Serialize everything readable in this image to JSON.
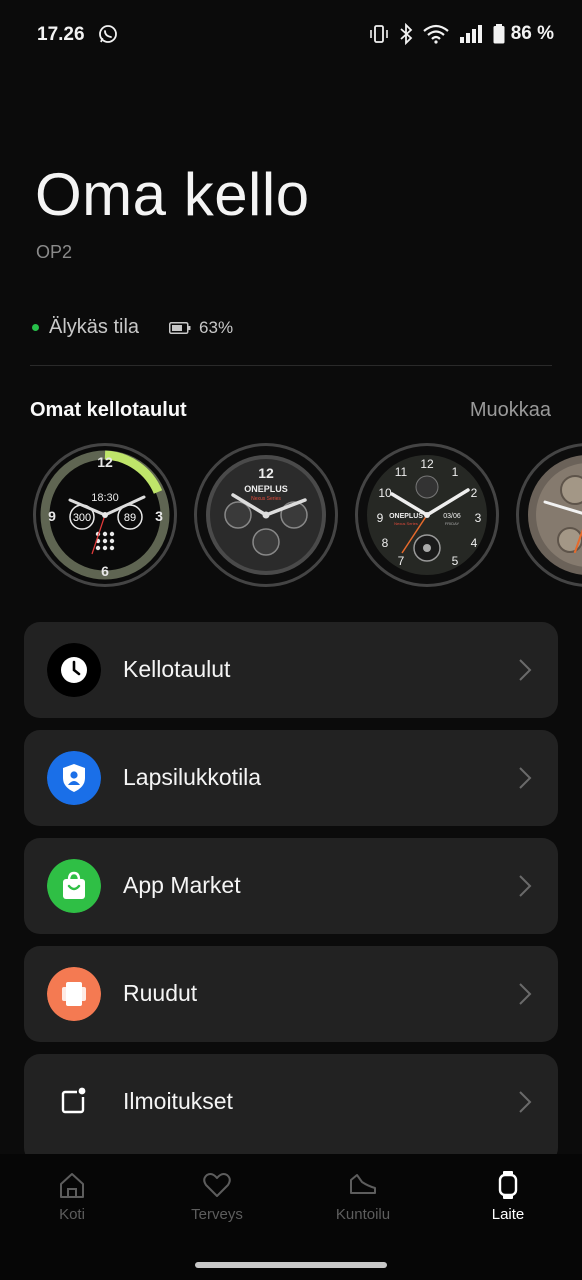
{
  "status_bar": {
    "time": "17.26",
    "battery": "86 %"
  },
  "header": {
    "title": "Oma kello",
    "device": "OP2"
  },
  "device_status": {
    "mode": "Älykäs tila",
    "battery": "63%"
  },
  "watch_faces": {
    "heading": "Omat kellotaulut",
    "edit_label": "Muokkaa",
    "faces": [
      {
        "time": "18:30",
        "left_value": "300",
        "right_value": "89",
        "top_number": "12",
        "left_number": "9",
        "right_number": "3",
        "bottom_number": "6"
      },
      {
        "brand": "ONEPLUS",
        "sub": "Nexus Series",
        "top_number": "12"
      },
      {
        "brand": "ONEPLUS",
        "sub": "Nexus Series",
        "date": "03/06",
        "day": "FRIDAY"
      },
      {
        "name": "chronograph"
      }
    ]
  },
  "menu": [
    {
      "label": "Kellotaulut",
      "icon": "clock-icon",
      "color": "#000000"
    },
    {
      "label": "Lapsilukkotila",
      "icon": "shield-user-icon",
      "color": "#1a6fe8"
    },
    {
      "label": "App Market",
      "icon": "shopping-bag-icon",
      "color": "#2fbf45"
    },
    {
      "label": "Ruudut",
      "icon": "tiles-icon",
      "color": "#f47a52"
    },
    {
      "label": "Ilmoitukset",
      "icon": "notification-icon",
      "color": "#222222"
    }
  ],
  "bottom_nav": [
    {
      "label": "Koti",
      "icon": "home-icon",
      "active": false
    },
    {
      "label": "Terveys",
      "icon": "heart-icon",
      "active": false
    },
    {
      "label": "Kuntoilu",
      "icon": "shoe-icon",
      "active": false
    },
    {
      "label": "Laite",
      "icon": "watch-icon",
      "active": true
    }
  ]
}
